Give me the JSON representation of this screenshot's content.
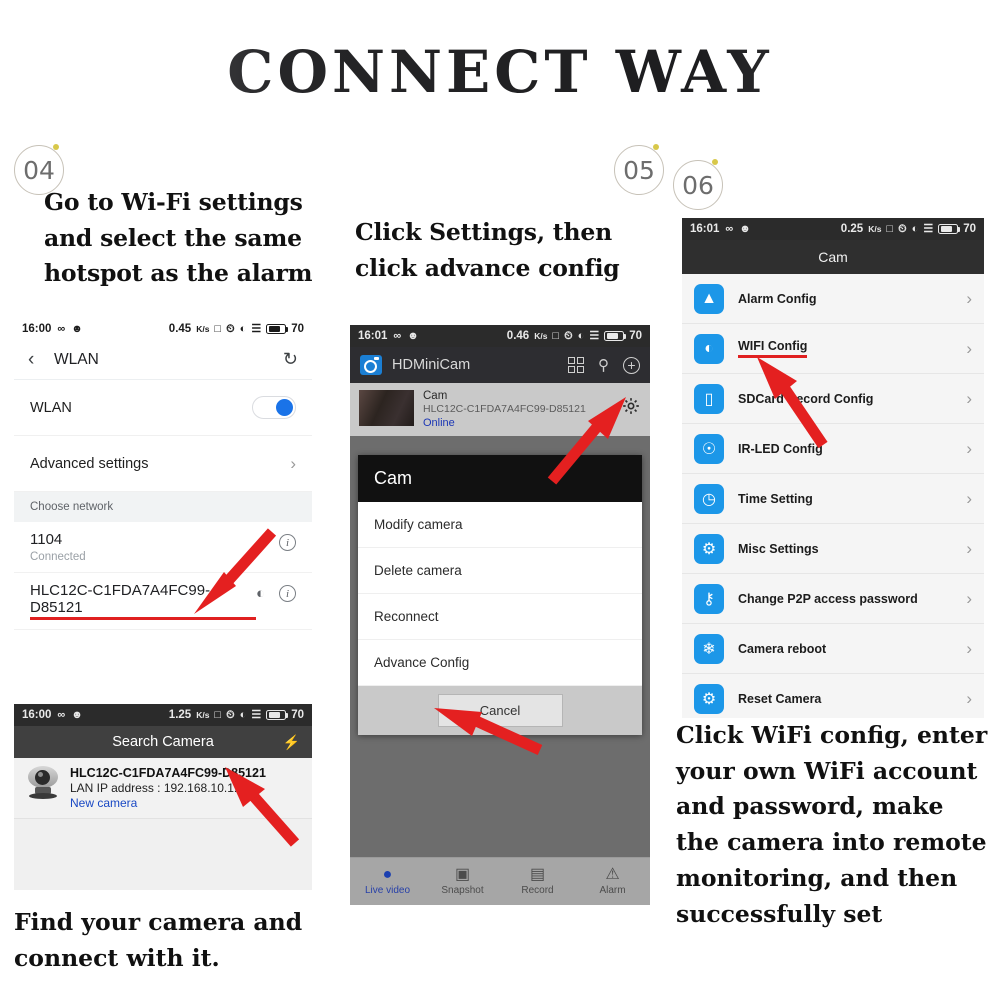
{
  "title": "CONNECT WAY",
  "steps": {
    "s04": "04",
    "s05": "05",
    "s06": "06"
  },
  "left": {
    "headline": "Go to Wi-Fi settings and select the same hotspot as the alarm",
    "footnote": "Find your camera and connect with it.",
    "wlan_screen": {
      "status": {
        "time": "16:00",
        "speed": "0.45",
        "speed_unit": "K/s",
        "battery": "70"
      },
      "back_icon": "chevron-left-icon",
      "title": "WLAN",
      "refresh_icon": "refresh-icon",
      "toggle_row_label": "WLAN",
      "advanced_label": "Advanced settings",
      "section_header": "Choose network",
      "networks": [
        {
          "name": "1104",
          "sub": "Connected",
          "highlighted": false
        },
        {
          "name": "HLC12C-C1FDA7A4FC99-D85121",
          "sub": "",
          "highlighted": true
        }
      ]
    },
    "search_screen": {
      "status": {
        "time": "16:00",
        "speed": "1.25",
        "speed_unit": "K/s",
        "battery": "70"
      },
      "title": "Search Camera",
      "camera": {
        "uid": "HLC12C-C1FDA7A4FC99-D85121",
        "lan": "LAN IP address : 192.168.10.1:80",
        "status": "New camera"
      }
    }
  },
  "middle": {
    "headline": "Click Settings, then click advance config",
    "app_screen": {
      "status": {
        "time": "16:01",
        "speed": "0.46",
        "speed_unit": "K/s",
        "battery": "70"
      },
      "app_name": "HDMiniCam",
      "camera": {
        "name": "Cam",
        "uid": "HLC12C-C1FDA7A4FC99-D85121",
        "status": "Online"
      },
      "dialog": {
        "title": "Cam",
        "items": [
          "Modify camera",
          "Delete camera",
          "Reconnect",
          "Advance Config"
        ],
        "cancel": "Cancel"
      },
      "tabs": [
        {
          "label": "Live video",
          "icon": "camera-lens-icon",
          "active": true
        },
        {
          "label": "Snapshot",
          "icon": "photo-icon",
          "active": false
        },
        {
          "label": "Record",
          "icon": "video-camera-icon",
          "active": false
        },
        {
          "label": "Alarm",
          "icon": "alarm-icon",
          "active": false
        }
      ]
    }
  },
  "right": {
    "settings_screen": {
      "status": {
        "time": "16:01",
        "speed": "0.25",
        "speed_unit": "K/s",
        "battery": "70"
      },
      "title": "Cam",
      "rows": [
        {
          "label": "Alarm Config",
          "icon": "warning-triangle-icon",
          "highlighted": false
        },
        {
          "label": "WIFI Config",
          "icon": "wifi-icon",
          "highlighted": true
        },
        {
          "label": "SDCard Record Config",
          "icon": "sdcard-icon",
          "highlighted": false
        },
        {
          "label": "IR-LED Config",
          "icon": "led-icon",
          "highlighted": false
        },
        {
          "label": "Time Setting",
          "icon": "clock-icon",
          "highlighted": false
        },
        {
          "label": "Misc Settings",
          "icon": "gear-icon",
          "highlighted": false
        },
        {
          "label": "Change P2P access password",
          "icon": "key-icon",
          "highlighted": false
        },
        {
          "label": "Camera reboot",
          "icon": "reboot-icon",
          "highlighted": false
        },
        {
          "label": "Reset Camera",
          "icon": "reset-gear-icon",
          "highlighted": false
        }
      ]
    },
    "footnote": "Click WiFi config, enter your own WiFi account and password, make the camera into remote monitoring, and then successfully set"
  },
  "colors": {
    "accent_red": "#e02020",
    "accent_blue": "#1c97e8",
    "link_blue": "#1a49c4"
  }
}
